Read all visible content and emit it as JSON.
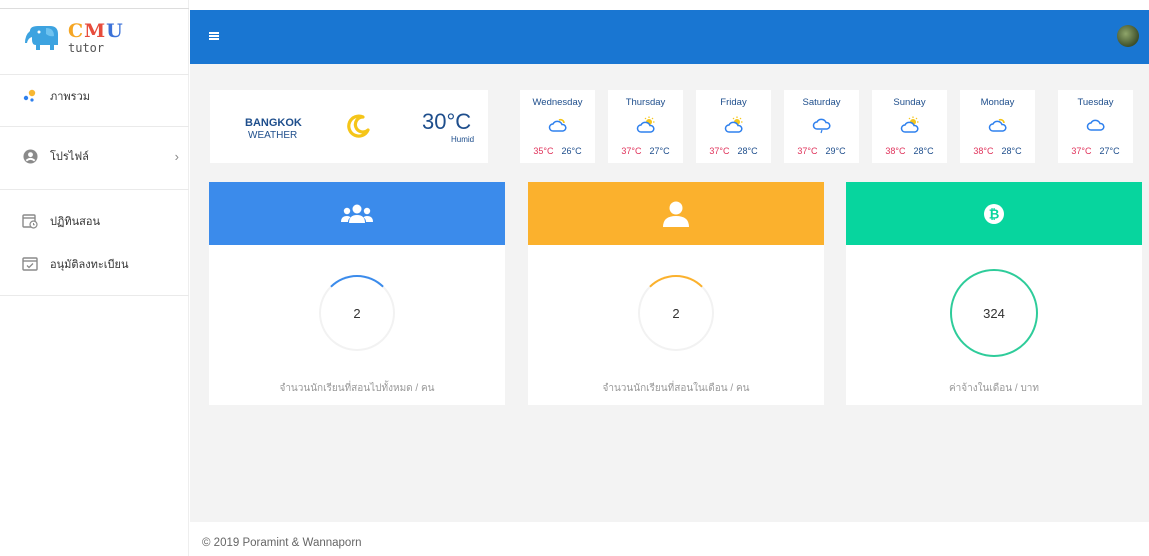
{
  "logo": {
    "cmu_c": "C",
    "cmu_m": "M",
    "cmu_u": "U",
    "sub": "tutor"
  },
  "sidebar": {
    "items": [
      {
        "label": "ภาพรวม",
        "icon": "dots-icon"
      },
      {
        "label": "โปรไฟล์",
        "icon": "user-circle-icon"
      },
      {
        "label": "ปฏิทินสอน",
        "icon": "calendar-clock-icon"
      },
      {
        "label": "อนุมัติลงทะเบียน",
        "icon": "calendar-check-icon"
      }
    ]
  },
  "weather": {
    "city": "BANGKOK",
    "label": "WEATHER",
    "temp": "30°C",
    "condition": "Humid",
    "days": [
      {
        "name": "Wednesday",
        "hi": "35°C",
        "lo": "26°C",
        "icon": "partly-cloudy-icon"
      },
      {
        "name": "Thursday",
        "hi": "37°C",
        "lo": "27°C",
        "icon": "sun-cloud-icon"
      },
      {
        "name": "Friday",
        "hi": "37°C",
        "lo": "28°C",
        "icon": "sun-cloud-icon"
      },
      {
        "name": "Saturday",
        "hi": "37°C",
        "lo": "29°C",
        "icon": "cloud-rain-icon"
      },
      {
        "name": "Sunday",
        "hi": "38°C",
        "lo": "28°C",
        "icon": "sun-cloud-icon"
      },
      {
        "name": "Monday",
        "hi": "38°C",
        "lo": "28°C",
        "icon": "partly-cloudy-icon"
      },
      {
        "name": "Tuesday",
        "hi": "37°C",
        "lo": "27°C",
        "icon": "cloud-icon"
      }
    ]
  },
  "cards": [
    {
      "value": "2",
      "label": "จำนวนนักเรียนที่สอนไปทั้งหมด / คน",
      "color": "#3b8beb",
      "icon": "users-icon"
    },
    {
      "value": "2",
      "label": "จำนวนนักเรียนที่สอนในเดือน / คน",
      "color": "#fbb12d",
      "icon": "user-icon"
    },
    {
      "value": "324",
      "label": "ค่าจ้างในเดือน / บาท",
      "color": "#07d59e",
      "icon": "bitcoin-icon"
    }
  ],
  "footer": "© 2019 Poramint & Wannaporn"
}
